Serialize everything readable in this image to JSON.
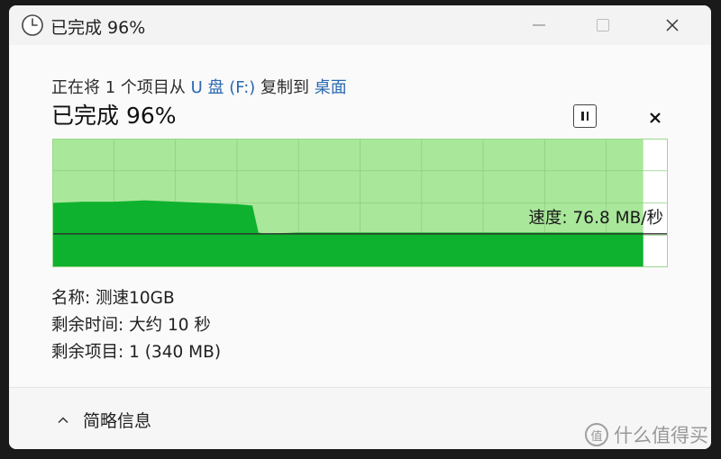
{
  "window": {
    "title": "已完成 96%",
    "icon": "clock-icon",
    "controls": {
      "minimize": "minimize-icon",
      "maximize": "maximize-icon",
      "close": "close-icon"
    }
  },
  "copy": {
    "prefix": "正在将 1 个项目从 ",
    "source": "U 盘 (F:)",
    "middle": " 复制到 ",
    "destination": "桌面"
  },
  "progress": {
    "title": "已完成 96%",
    "percent": 96,
    "pause_icon": "pause-icon",
    "cancel_icon": "x-icon"
  },
  "chart_data": {
    "type": "area",
    "speed_label": "速度: 76.8 MB/秒",
    "progress_fraction": 0.96,
    "speed_profile": [
      [
        0.0,
        0.5
      ],
      [
        0.05,
        0.51
      ],
      [
        0.1,
        0.51
      ],
      [
        0.15,
        0.52
      ],
      [
        0.2,
        0.51
      ],
      [
        0.25,
        0.5
      ],
      [
        0.3,
        0.49
      ],
      [
        0.325,
        0.48
      ],
      [
        0.335,
        0.27
      ],
      [
        0.345,
        0.26
      ],
      [
        0.4,
        0.27
      ],
      [
        0.5,
        0.27
      ],
      [
        0.6,
        0.27
      ],
      [
        0.7,
        0.27
      ],
      [
        0.8,
        0.27
      ],
      [
        0.9,
        0.27
      ],
      [
        0.96,
        0.27
      ]
    ],
    "speed_line_level": 0.26,
    "colors": {
      "background": "#ffffff",
      "progress_fill": "#a9e79b",
      "speed_fill": "#0fb22e",
      "grid": "#8fd080",
      "line": "#2e2e2e"
    }
  },
  "details": {
    "name": "名称: 测速10GB",
    "time_remaining": "剩余时间: 大约 10 秒",
    "items_remaining": "剩余项目: 1 (340 MB)"
  },
  "footer": {
    "label": "简略信息",
    "icon": "chevron-up-icon"
  },
  "watermark": {
    "badge": "值",
    "text": "什么值得买"
  }
}
